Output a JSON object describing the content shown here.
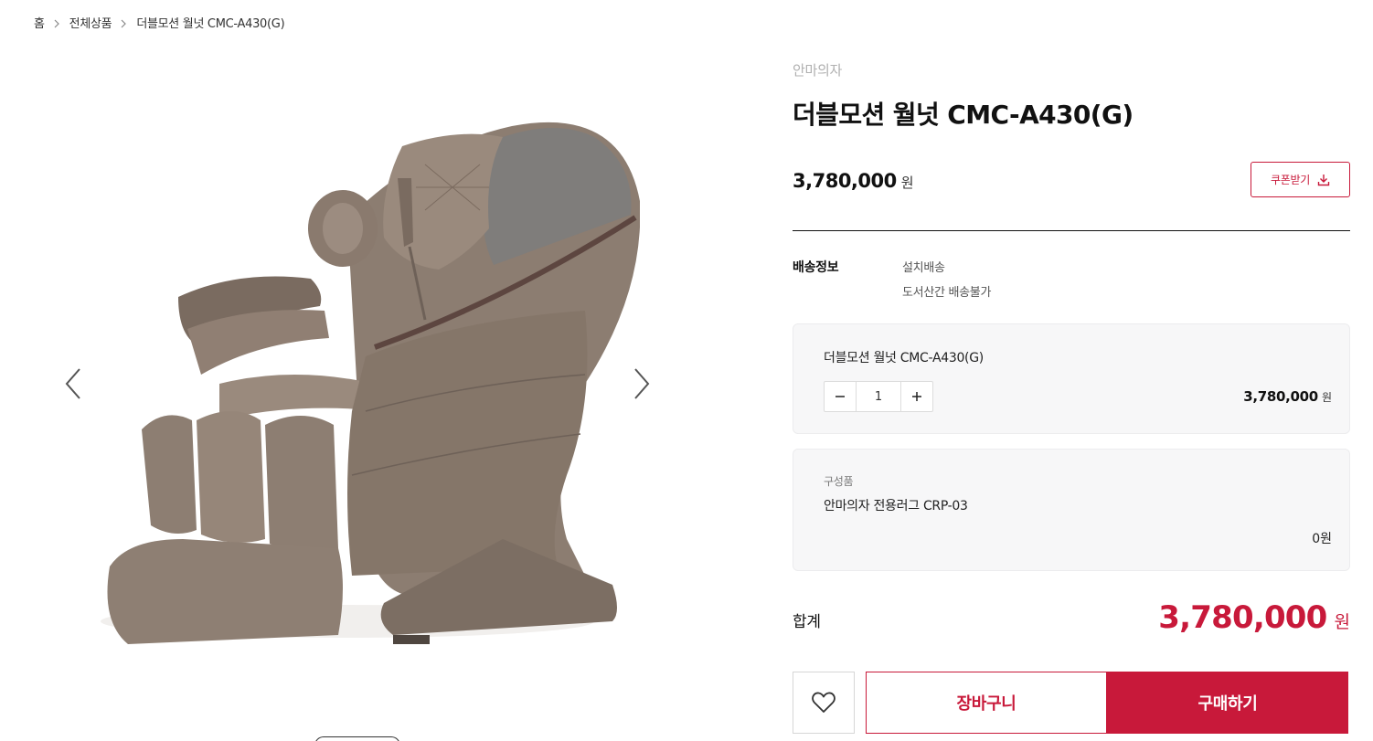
{
  "breadcrumb": {
    "home": "홈",
    "all_products": "전체상품",
    "current": "더블모션 월넛 CMC-A430(G)"
  },
  "product": {
    "category": "안마의자",
    "title": "더블모션 월넛 CMC-A430(G)",
    "price": "3,780,000",
    "price_unit": "원",
    "coupon_label": "쿠폰받기",
    "coupon_icon": "download-icon"
  },
  "shipping": {
    "label": "배송정보",
    "method": "설치배송",
    "restriction": "도서산간 배송불가"
  },
  "option": {
    "name": "더블모션 월넛 CMC-A430(G)",
    "quantity": "1",
    "price": "3,780,000",
    "price_unit": "원"
  },
  "component": {
    "label": "구성품",
    "name": "안마의자 전용러그 CRP-03",
    "price": "0원"
  },
  "total": {
    "label": "합계",
    "price": "3,780,000",
    "unit": "원"
  },
  "actions": {
    "wishlist_icon": "heart-icon",
    "cart_label": "장바구니",
    "buy_label": "구매하기"
  },
  "gallery": {
    "prev_icon": "chevron-left-icon",
    "next_icon": "chevron-right-icon"
  },
  "colors": {
    "accent": "#c8193a",
    "chair_body": "#8a7b6f",
    "chair_dark": "#6e6158",
    "chair_panel": "#7f7d7b",
    "box_bg": "#f7f7f8"
  }
}
